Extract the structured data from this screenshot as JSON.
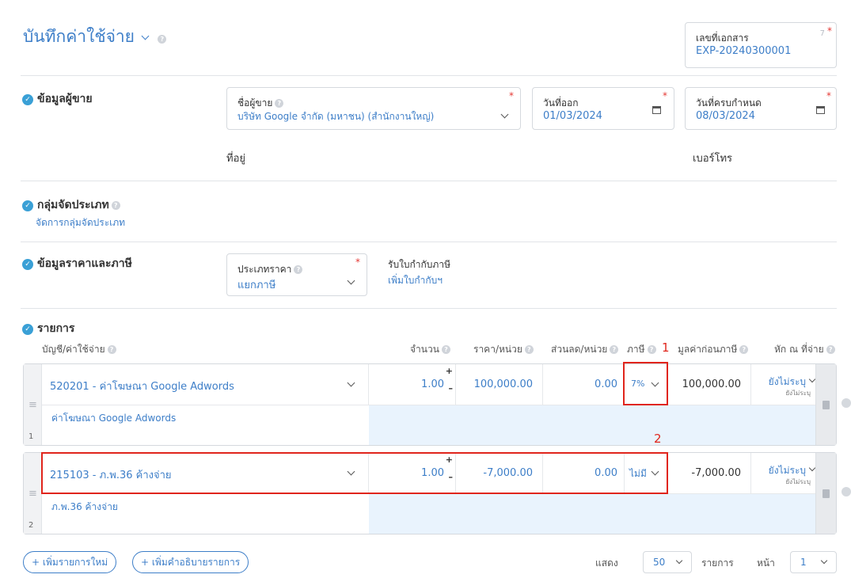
{
  "header": {
    "title": "บันทึกค่าใช้จ่าย",
    "doc_number_label": "เลขที่เอกสาร",
    "doc_number_value": "EXP-20240300001",
    "doc_number_counter": "7"
  },
  "vendor_section": {
    "title": "ข้อมูลผู้ขาย",
    "vendor_label": "ชื่อผู้ขาย",
    "vendor_value": "บริษัท Google จำกัด (มหาชน) (สำนักงานใหญ่)",
    "issue_date_label": "วันที่ออก",
    "issue_date_value": "01/03/2024",
    "due_date_label": "วันที่ครบกำหนด",
    "due_date_value": "08/03/2024",
    "address_label": "ที่อยู่",
    "phone_label": "เบอร์โทร"
  },
  "category_section": {
    "title": "กลุ่มจัดประเภท",
    "link": "จัดการกลุ่มจัดประเภท"
  },
  "price_section": {
    "title": "ข้อมูลราคาและภาษี",
    "price_type_label": "ประเภทราคา",
    "price_type_value": "แยกภาษี",
    "tax_invoice_label": "รับใบกำกับภาษี",
    "tax_invoice_link": "เพิ่มใบกำกับฯ"
  },
  "items_section": {
    "title": "รายการ",
    "columns": {
      "account": "บัญชี/ค่าใช้จ่าย",
      "qty": "จำนวน",
      "price": "ราคา/หน่วย",
      "discount": "ส่วนลด/หน่วย",
      "tax": "ภาษี",
      "pretax": "มูลค่าก่อนภาษี",
      "withhold": "หัก ณ ที่จ่าย"
    },
    "rows": [
      {
        "num": "1",
        "account": "520201 - ค่าโฆษณา Google Adwords",
        "description": "ค่าโฆษณา Google Adwords",
        "qty": "1.00",
        "price": "100,000.00",
        "discount": "0.00",
        "tax": "7%",
        "pretax": "100,000.00",
        "withhold": "ยังไม่ระบุ",
        "withhold_sub": "ยังไม่ระบุ"
      },
      {
        "num": "2",
        "account": "215103 - ภ.พ.36 ค้างจ่าย",
        "description": "ภ.พ.36 ค้างจ่าย",
        "qty": "1.00",
        "price": "-7,000.00",
        "discount": "0.00",
        "tax": "ไม่มี",
        "pretax": "-7,000.00",
        "withhold": "ยังไม่ระบุ",
        "withhold_sub": "ยังไม่ระบุ"
      }
    ]
  },
  "annotations": {
    "a1": "1",
    "a2": "2"
  },
  "footer": {
    "add_item": "+ เพิ่มรายการใหม่",
    "add_desc": "+ เพิ่มคำอธิบายรายการ",
    "show_label": "แสดง",
    "page_size": "50",
    "items_label": "รายการ",
    "page_label": "หน้า",
    "page_value": "1"
  },
  "colors": {
    "accent": "#3d7ec8",
    "check": "#3aa0d6",
    "highlight": "#e0251c",
    "row_fill": "#e9f3fd"
  }
}
